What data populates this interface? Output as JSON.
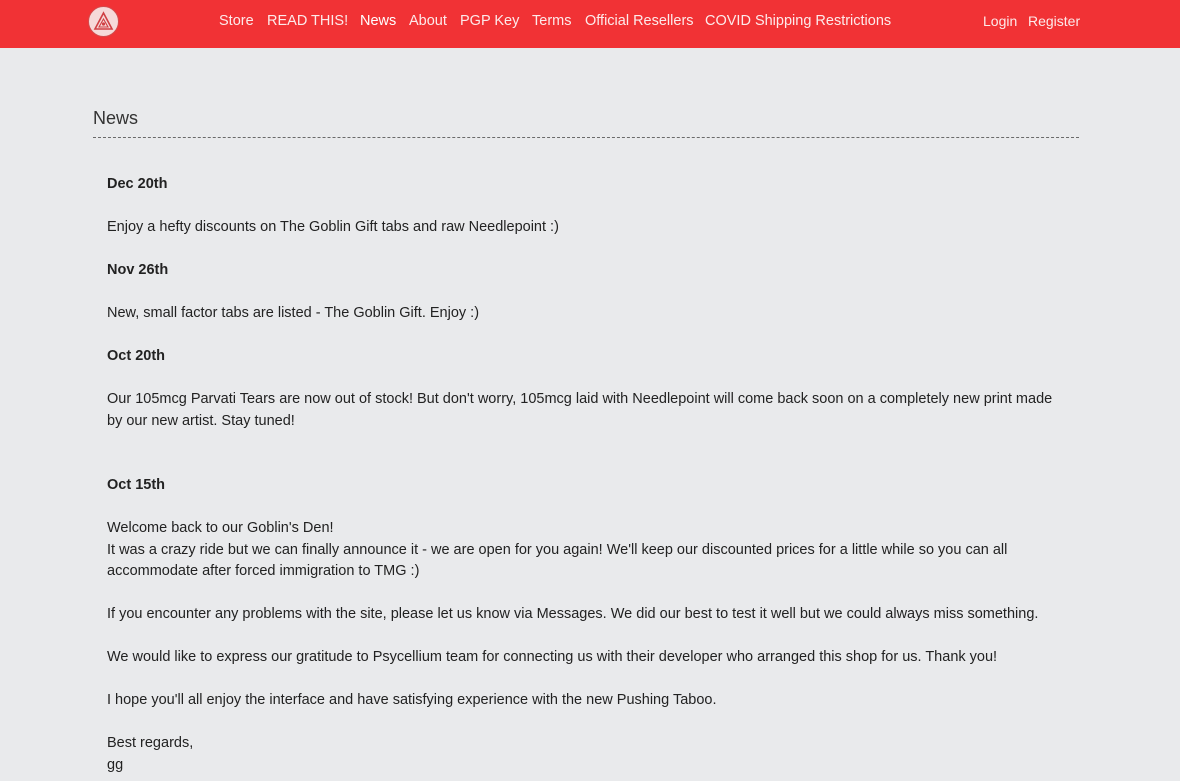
{
  "nav": {
    "links": [
      "Store",
      "READ THIS!",
      "News",
      "About",
      "PGP Key",
      "Terms",
      "Official Resellers",
      "COVID Shipping Restrictions"
    ],
    "login": "Login",
    "register": "Register"
  },
  "page": {
    "heading": "News"
  },
  "news": {
    "dec20_date": "Dec 20th",
    "dec20_text": "Enjoy a hefty discounts on The Goblin Gift tabs and raw Needlepoint :)",
    "nov26_date": "Nov 26th",
    "nov26_text": "New, small factor tabs are listed - The Goblin Gift. Enjoy :)",
    "oct20_date": "Oct 20th",
    "oct20_text": "Our 105mcg Parvati Tears are now out of stock! But don't worry, 105mcg laid with Needlepoint will come back soon on a completely new print made by our new artist. Stay tuned!",
    "oct15_date": "Oct 15th",
    "oct15_line1": "Welcome back to our Goblin's Den!",
    "oct15_line2": "It was a crazy ride but we can finally announce it - we are open for you again! We'll keep our discounted prices for a little while so you can all accommodate after forced immigration to TMG :)",
    "oct15_line3": "If you encounter any problems with the site, please let us know via Messages. We did our best to test it well but we could always miss something.",
    "oct15_line4": "We would like to express our gratitude to Psycellium team for connecting us with their developer who arranged this shop for us. Thank you!",
    "oct15_line5": "I hope you'll all enjoy the interface and have satisfying experience with the new Pushing Taboo.",
    "oct15_signoff": "Best regards,",
    "oct15_signature": "gg"
  },
  "icons": {
    "logo": "triangle-logo-icon"
  },
  "colors": {
    "navbar": "#f13235",
    "background": "#e9eaec"
  }
}
